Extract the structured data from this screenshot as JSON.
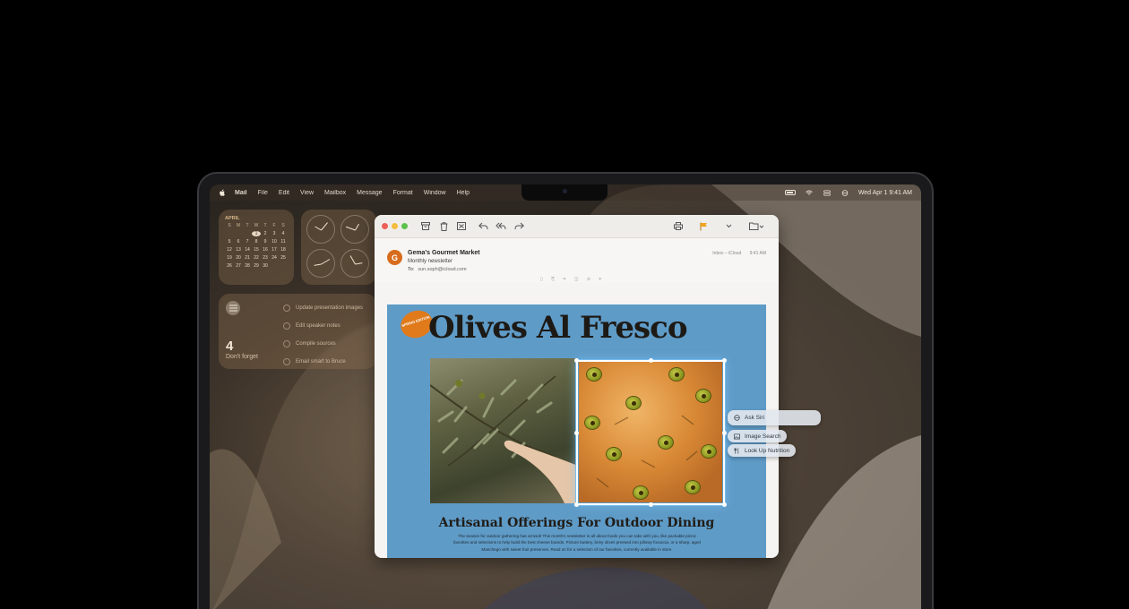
{
  "menubar": {
    "items": [
      "Mail",
      "File",
      "Edit",
      "View",
      "Mailbox",
      "Message",
      "Format",
      "Window",
      "Help"
    ],
    "datetime": "Wed Apr 1  9:41 AM"
  },
  "calendar": {
    "month": "APRIL",
    "weekdays": [
      "S",
      "M",
      "T",
      "W",
      "T",
      "F",
      "S"
    ],
    "days": [
      "",
      "",
      "",
      "1",
      "2",
      "3",
      "4",
      "5",
      "6",
      "7",
      "8",
      "9",
      "10",
      "11",
      "12",
      "13",
      "14",
      "15",
      "16",
      "17",
      "18",
      "19",
      "20",
      "21",
      "22",
      "23",
      "24",
      "25",
      "26",
      "27",
      "28",
      "29",
      "30",
      "",
      ""
    ],
    "today": "1"
  },
  "reminders": {
    "count": "4",
    "label": "Don't forget",
    "items": [
      "Update presentation images",
      "Edit speaker notes",
      "Compile sources",
      "Email smart to Bruce"
    ]
  },
  "mail": {
    "sender": "Gema's Gourmet Market",
    "subject": "Monthly newsletter",
    "to_label": "To:",
    "to_address": "sun.soph@icloud.com",
    "mailbox": "Inbox – iCloud",
    "time": "9:41 AM",
    "avatar_letter": "G"
  },
  "newsletter": {
    "badge": "SPRING EDITION",
    "headline": "Olives Al Fresco",
    "subhead": "Artisanal Offerings For Outdoor Dining",
    "body": "The season for outdoor gathering has arrived! This month's newsletter is all about foods you can take with you, like packable picnic favorites and selections to help build the best cheese boards. Picture buttery, briny olives pressed into pillowy focaccia, or a sharp, aged Manchego with sweet fruit preserves. Read on for a selection of our favorites, currently available in store."
  },
  "context_menu": {
    "ask_siri": "Ask Siri",
    "image_search": "Image Search",
    "look_up_nutrition": "Look Up Nutrition"
  },
  "colors": {
    "newsletter_bg": "#5f9bc7",
    "badge": "#e07a1a",
    "avatar": "#d86c1d",
    "flag": "#f2a31b"
  }
}
